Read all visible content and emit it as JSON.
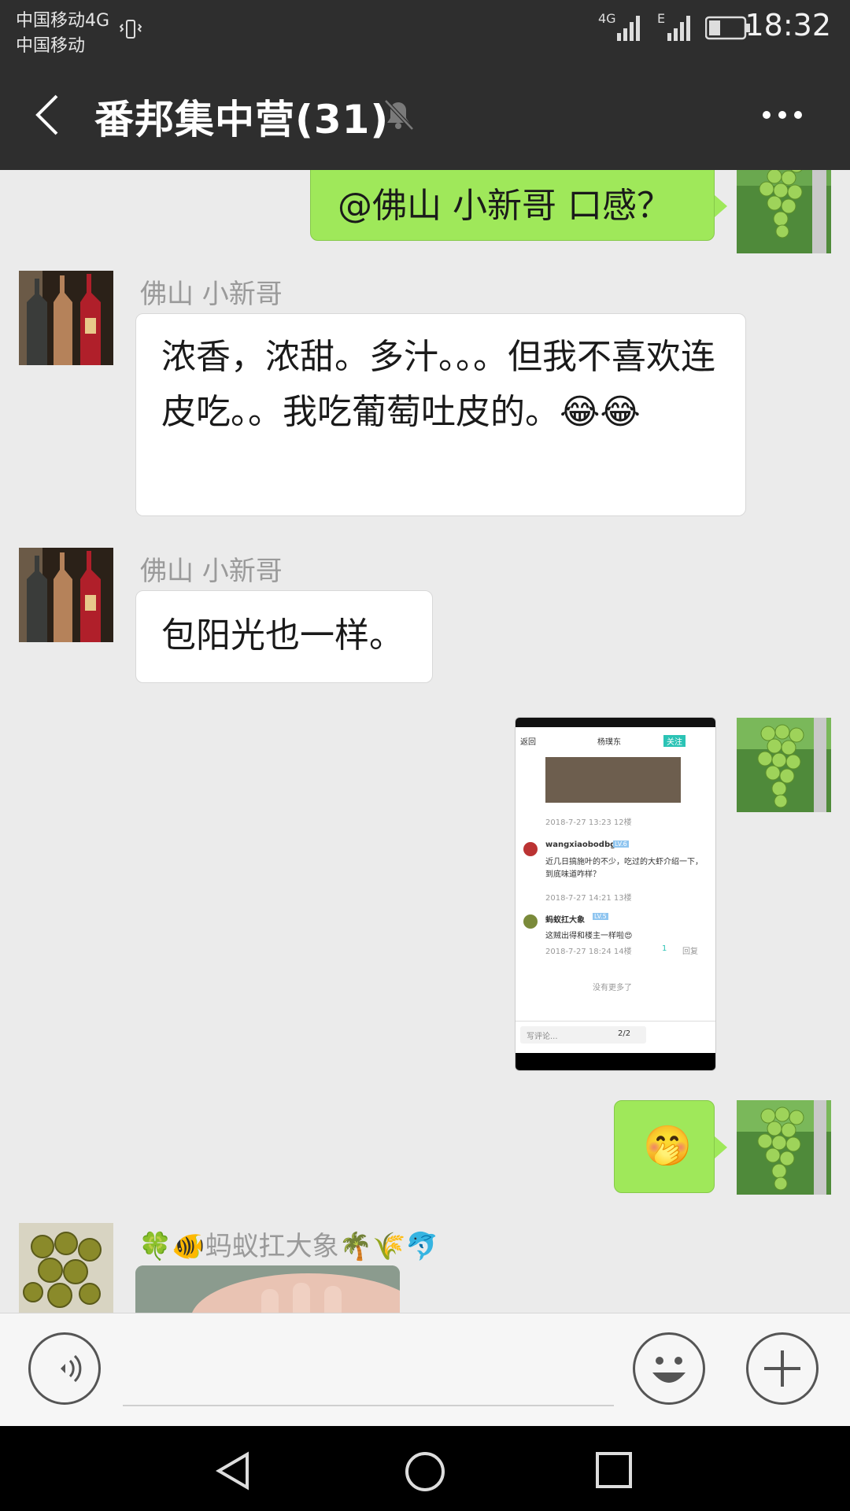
{
  "status_bar": {
    "carrier_line1": "中国移动4G",
    "carrier_line2": "中国移动",
    "network_4g": "4G",
    "network_e": "E",
    "time": "18:32"
  },
  "header": {
    "back_icon": "chevron-left-icon",
    "title": "番邦集中营(31)",
    "mute_icon": "bell-off-icon",
    "more_icon": "more-dots-icon"
  },
  "messages": [
    {
      "side": "right",
      "text": "@佛山 小新哥  口感？"
    },
    {
      "side": "left",
      "nick": "佛山 小新哥",
      "text": "浓香，浓甜。多汁。。。但我不喜欢连皮吃。。我吃葡萄吐皮的。😂😂"
    },
    {
      "side": "left",
      "nick": "佛山 小新哥",
      "text": "包阳光也一样。"
    },
    {
      "side": "right",
      "type": "image"
    },
    {
      "side": "right",
      "text": "🤭"
    },
    {
      "side": "left",
      "nick": "🍀🐠蚂蚁扛大象🌴🌾🐬",
      "type": "image"
    }
  ],
  "thumb": {
    "back": "返回",
    "user": "杨璞东",
    "follow": "关注",
    "post1_meta": "2018-7-27 13:23  12楼",
    "c1_user": "wangxiaobodbg",
    "c1_badge": "LV.6",
    "c1_text": "近几日搞施叶的不少，吃过的大虾介绍一下，到底味道咋样？",
    "c1_meta": "2018-7-27 14:21  13楼",
    "c2_user": "蚂蚁扛大象",
    "c2_badge": "LV.5",
    "c2_text": "这贼出得和楼主一样啦😍",
    "c2_meta": "2018-7-27 18:24  14楼",
    "c2_likes": "1",
    "c2_reply": "回复",
    "no_more": "没有更多了",
    "write": "写评论...",
    "page": "2/2"
  },
  "input_bar": {
    "voice_icon": "voice-icon",
    "emoji_icon": "emoji-icon",
    "plus_icon": "plus-icon"
  },
  "nav_bar": {
    "back_icon": "nav-back-icon",
    "home_icon": "nav-home-icon",
    "recents_icon": "nav-recents-icon"
  },
  "colors": {
    "header_bg": "#2e2e2e",
    "chat_bg": "#ebebeb",
    "bubble_self": "#9fe85a",
    "bubble_other": "#ffffff"
  }
}
